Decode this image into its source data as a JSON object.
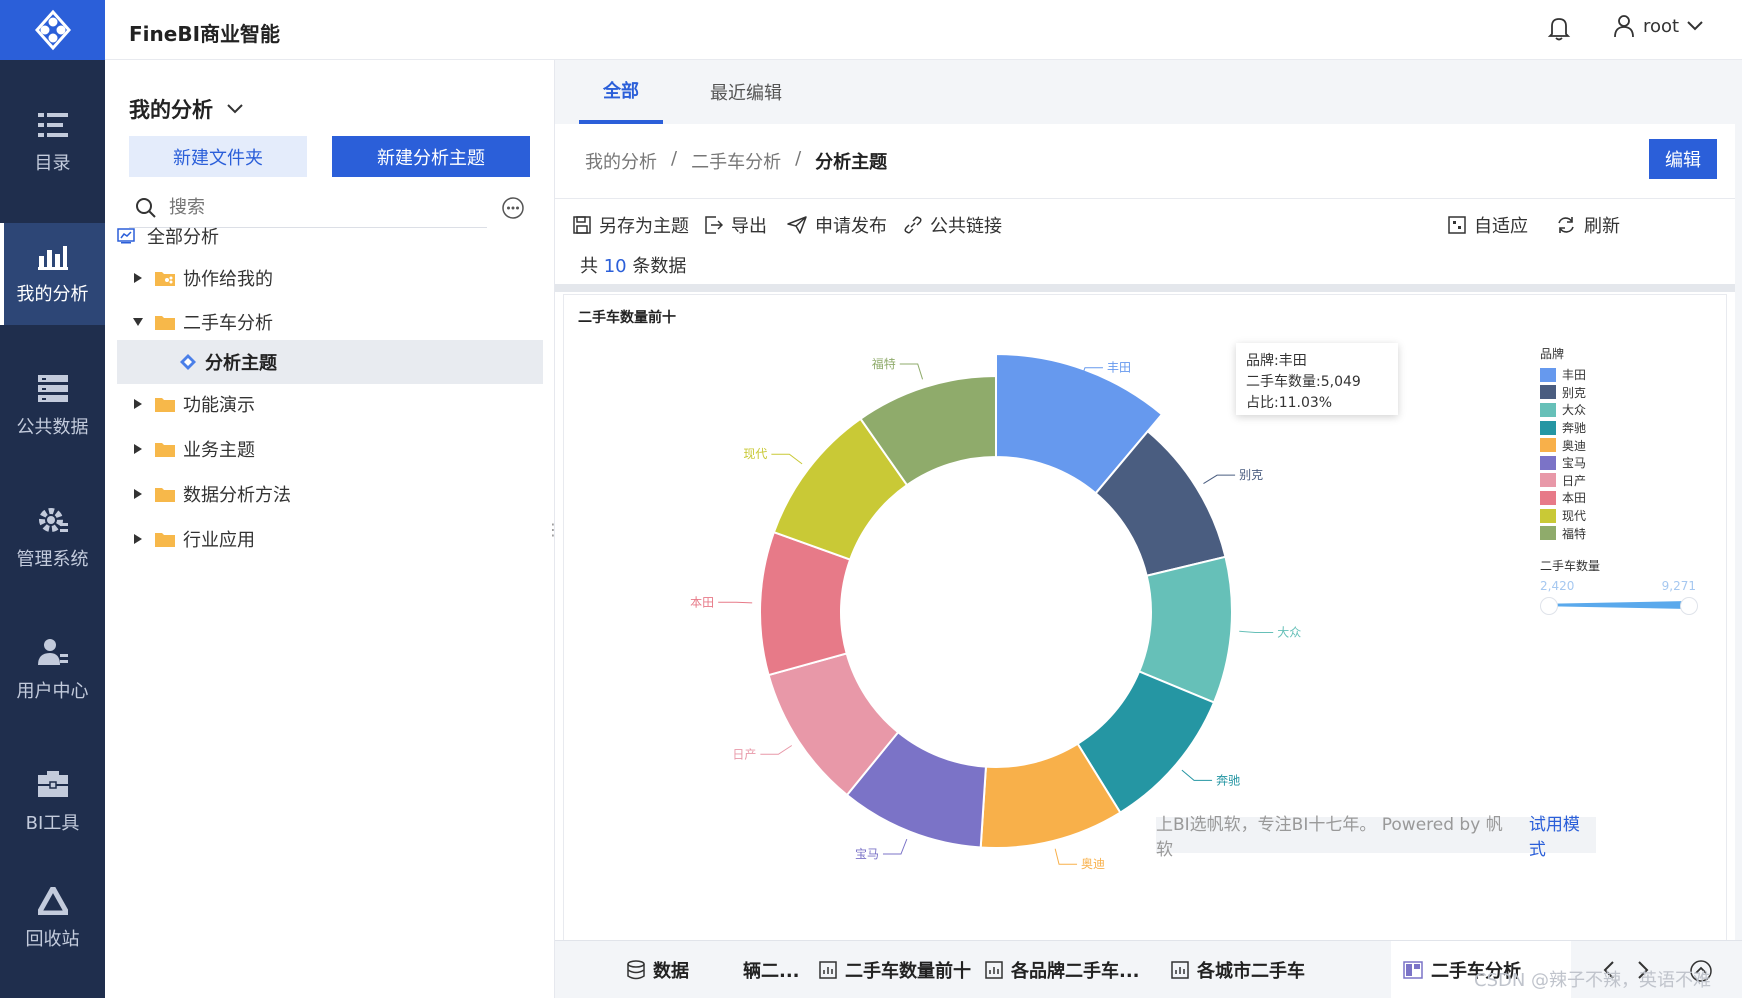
{
  "app": {
    "title": "FineBI商业智能"
  },
  "user": {
    "name": "root"
  },
  "nav": {
    "items": [
      {
        "label": "目录",
        "icon": "catalog-icon"
      },
      {
        "label": "我的分析",
        "icon": "chart-icon",
        "active": true
      },
      {
        "label": "公共数据",
        "icon": "database-icon"
      },
      {
        "label": "管理系统",
        "icon": "gear-icon"
      },
      {
        "label": "用户中心",
        "icon": "user-icon"
      },
      {
        "label": "BI工具",
        "icon": "toolbox-icon"
      },
      {
        "label": "回收站",
        "icon": "recycle-icon"
      }
    ]
  },
  "panel": {
    "title": "我的分析",
    "new_folder": "新建文件夹",
    "new_topic": "新建分析主题",
    "search_placeholder": "搜索",
    "tree": [
      {
        "label": "全部分析",
        "type": "root"
      },
      {
        "label": "协作给我的",
        "type": "shared",
        "caret": "right"
      },
      {
        "label": "二手车分析",
        "type": "folder",
        "caret": "down"
      },
      {
        "label": "分析主题",
        "type": "topic",
        "selected": true
      },
      {
        "label": "功能演示",
        "type": "folder",
        "caret": "right"
      },
      {
        "label": "业务主题",
        "type": "folder",
        "caret": "right"
      },
      {
        "label": "数据分析方法",
        "type": "folder",
        "caret": "right"
      },
      {
        "label": "行业应用",
        "type": "folder",
        "caret": "right"
      }
    ]
  },
  "main": {
    "tabs": [
      {
        "label": "全部"
      },
      {
        "label": "最近编辑"
      }
    ],
    "breadcrumb": [
      "我的分析",
      "/",
      "二手车分析",
      "/",
      "分析主题"
    ],
    "edit_label": "编辑",
    "toolbar": {
      "save_as": "另存为主题",
      "export": "导出",
      "publish": "申请发布",
      "public_link": "公共链接",
      "fit": "自适应",
      "refresh": "刷新"
    },
    "count_prefix": "共",
    "count_value": "10",
    "count_suffix": "条数据",
    "watermark": "上BI选帆软，专注BI十七年。 Powered by 帆软",
    "trial": "试用模式"
  },
  "chart_data": {
    "type": "pie",
    "title": "二手车数量前十",
    "legend_title": "品牌",
    "legend_position": "right",
    "categories": [
      "丰田",
      "别克",
      "大众",
      "奔驰",
      "奥迪",
      "宝马",
      "日产",
      "本田",
      "现代",
      "福特"
    ],
    "values": [
      5049,
      4600,
      4550,
      4500,
      4480,
      4470,
      4460,
      4450,
      4440,
      4420
    ],
    "colors": [
      "#6699ee",
      "#4a5d80",
      "#66c0b8",
      "#2596a3",
      "#f8b04a",
      "#7b73c7",
      "#e898a8",
      "#e77a88",
      "#c9c936",
      "#8fab6b"
    ],
    "tooltip": {
      "brand_line": "品牌:丰田",
      "count_line": "二手车数量:5,049",
      "ratio_line": "占比:11.03%"
    },
    "range": {
      "title": "二手车数量",
      "min": "2,420",
      "max": "9,271"
    }
  },
  "bottom_tabs": [
    {
      "label": "数据",
      "icon": "database-icon"
    },
    {
      "label": "辆二...",
      "icon": ""
    },
    {
      "label": "二手车数量前十",
      "icon": "bar-chart-icon"
    },
    {
      "label": "各品牌二手车...",
      "icon": "bar-chart-icon"
    },
    {
      "label": "各城市二手车",
      "icon": "bar-chart-icon"
    },
    {
      "label": "二手车分析",
      "icon": "dashboard-icon",
      "active": true
    }
  ],
  "csdn": "CSDN @辣子不辣，英语不难"
}
